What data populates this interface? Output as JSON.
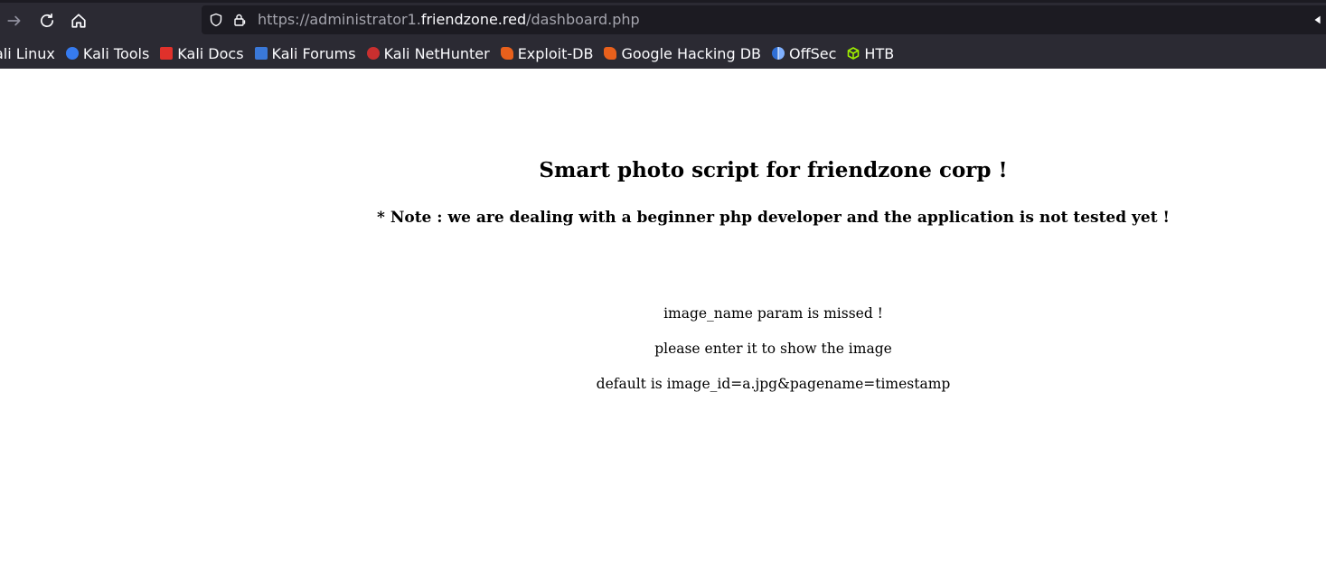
{
  "browser": {
    "url_scheme_prefix": "https://administrator1.",
    "url_host": "friendzone.red",
    "url_path": "/dashboard.php",
    "bookmarks": [
      {
        "label": "ali Linux",
        "icon": "kali-linux-icon",
        "color": "#367bf0"
      },
      {
        "label": "Kali Tools",
        "icon": "kali-tools-icon",
        "color": "#d8372a"
      },
      {
        "label": "Kali Docs",
        "icon": "kali-docs-icon",
        "color": "#e0312b"
      },
      {
        "label": "Kali Forums",
        "icon": "kali-forums-icon",
        "color": "#3a78d8"
      },
      {
        "label": "Kali NetHunter",
        "icon": "kali-nethunter-icon",
        "color": "#c92f2f"
      },
      {
        "label": "Exploit-DB",
        "icon": "exploit-db-icon",
        "color": "#e8601c"
      },
      {
        "label": "Google Hacking DB",
        "icon": "ghdb-icon",
        "color": "#e8601c"
      },
      {
        "label": "OffSec",
        "icon": "offsec-icon",
        "color": "#2f6fd6"
      },
      {
        "label": "HTB",
        "icon": "htb-icon",
        "color": "#9fef00"
      }
    ]
  },
  "page": {
    "title": "Smart photo script for friendzone corp !",
    "note": "* Note : we are dealing with a beginner php developer and the application is not tested yet !",
    "message_1": "image_name param is missed !",
    "message_2": "please enter it to show the image",
    "message_3": "default is image_id=a.jpg&pagename=timestamp"
  }
}
